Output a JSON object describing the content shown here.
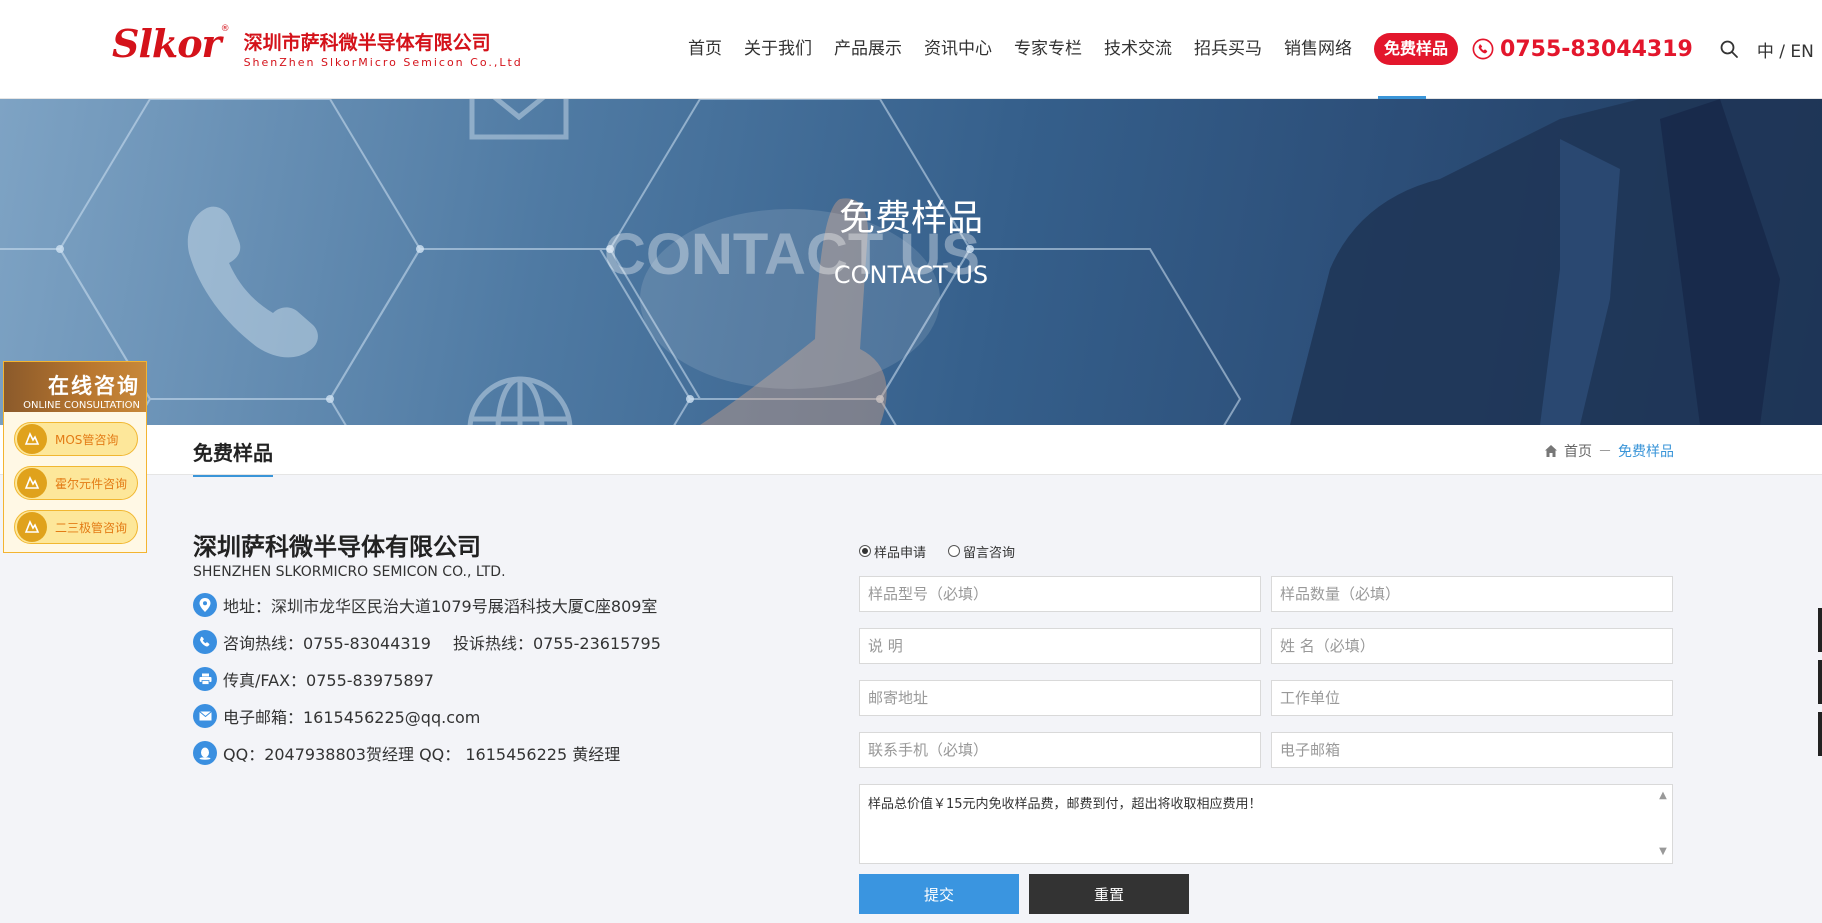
{
  "header": {
    "logo": {
      "mark": "Slkor",
      "reg": "®",
      "cn": "深圳市萨科微半导体有限公司",
      "en": "ShenZhen SlkorMicro Semicon Co.,Ltd"
    },
    "nav": [
      "首页",
      "关于我们",
      "产品展示",
      "资讯中心",
      "专家专栏",
      "技术交流",
      "招兵买马",
      "销售网络"
    ],
    "cta": "免费样品",
    "phone": "0755-83044319",
    "lang": {
      "cn": "中",
      "sep": " / ",
      "en": "EN"
    }
  },
  "banner": {
    "title": "免费样品",
    "subtitle": "CONTACT US",
    "bg_text": "CONTACT US"
  },
  "subbar": {
    "title": "免费样品",
    "breadcrumb": {
      "home": "首页",
      "sep": "－",
      "current": "免费样品"
    }
  },
  "consult": {
    "title": "在线咨询",
    "subtitle": "ONLINE CONSULTATION",
    "items": [
      "MOS管咨询",
      "霍尔元件咨询",
      "二三极管咨询"
    ]
  },
  "company": {
    "name": "深圳萨科微半导体有限公司",
    "name_en": "SHENZHEN SLKORMICRO SEMICON CO., LTD.",
    "address": "地址：深圳市龙华区民治大道1079号展滔科技大厦C座809室",
    "hotline": "咨询热线：0755-83044319",
    "complaint": "投诉热线：0755-23615795",
    "fax": "传真/FAX：0755-83975897",
    "email": "电子邮箱：1615456225@qq.com",
    "qq": "QQ：2047938803贺经理  QQ： 1615456225 黄经理"
  },
  "form": {
    "radio_sample": "样品申请",
    "radio_message": "留言咨询",
    "placeholders": {
      "model": "样品型号（必填）",
      "qty": "样品数量（必填）",
      "desc": "说 明",
      "name": "姓 名（必填）",
      "address": "邮寄地址",
      "company": "工作单位",
      "mobile": "联系手机（必填）",
      "email": "电子邮箱"
    },
    "note": "样品总价值￥15元内免收样品费，邮费到付，超出将收取相应费用！",
    "submit": "提交",
    "reset": "重置"
  },
  "colors": {
    "brand_red": "#e3162c",
    "accent_blue": "#3a95d8",
    "consult_orange": "#f1b731"
  }
}
